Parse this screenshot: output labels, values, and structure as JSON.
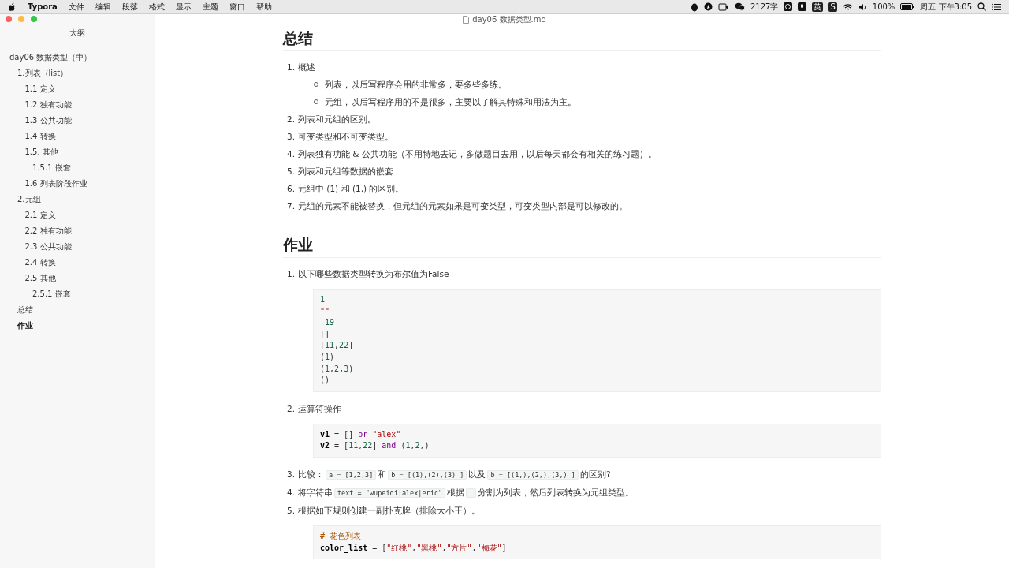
{
  "menubar": {
    "app": "Typora",
    "menus": [
      "文件",
      "编辑",
      "段落",
      "格式",
      "显示",
      "主题",
      "窗口",
      "帮助"
    ],
    "status": {
      "word_count": "2127字",
      "input_method": "英",
      "sogou": "S",
      "battery": "100%",
      "clock": "周五 下午3:05"
    }
  },
  "window": {
    "title": "day06 数据类型.md"
  },
  "sidebar": {
    "title": "大纲",
    "items": [
      {
        "label": "day06 数据类型（中）",
        "selected": false,
        "children": [
          {
            "label": "1.列表（list）",
            "selected": false,
            "children": [
              {
                "label": "1.1 定义",
                "selected": false
              },
              {
                "label": "1.2 独有功能",
                "selected": false
              },
              {
                "label": "1.3 公共功能",
                "selected": false
              },
              {
                "label": "1.4 转换",
                "selected": false
              },
              {
                "label": "1.5. 其他",
                "selected": false,
                "children": [
                  {
                    "label": "1.5.1 嵌套",
                    "selected": false
                  }
                ]
              },
              {
                "label": "1.6 列表阶段作业",
                "selected": false
              }
            ]
          },
          {
            "label": "2.元组",
            "selected": false,
            "children": [
              {
                "label": "2.1 定义",
                "selected": false
              },
              {
                "label": "2.2 独有功能",
                "selected": false
              },
              {
                "label": "2.3 公共功能",
                "selected": false
              },
              {
                "label": "2.4 转换",
                "selected": false
              },
              {
                "label": "2.5 其他",
                "selected": false,
                "children": [
                  {
                    "label": "2.5.1 嵌套",
                    "selected": false
                  }
                ]
              }
            ]
          },
          {
            "label": "总结",
            "selected": false
          },
          {
            "label": "作业",
            "selected": true
          }
        ]
      }
    ]
  },
  "document": {
    "sections": [
      {
        "heading": "总结",
        "items": [
          {
            "number": "1.",
            "parts": [
              {
                "kind": "text",
                "text": "概述"
              }
            ],
            "bullets": [
              "列表，以后写程序会用的非常多，要多些多练。",
              "元组，以后写程序用的不是很多，主要以了解其特殊和用法为主。"
            ]
          },
          {
            "number": "2.",
            "parts": [
              {
                "kind": "text",
                "text": "列表和元组的区别。"
              }
            ]
          },
          {
            "number": "3.",
            "parts": [
              {
                "kind": "text",
                "text": "可变类型和不可变类型。"
              }
            ]
          },
          {
            "number": "4.",
            "parts": [
              {
                "kind": "text",
                "text": "列表独有功能 & 公共功能（不用特地去记，多做题目去用，以后每天都会有相关的练习题）。"
              }
            ]
          },
          {
            "number": "5.",
            "parts": [
              {
                "kind": "text",
                "text": "列表和元组等数据的嵌套"
              }
            ]
          },
          {
            "number": "6.",
            "parts": [
              {
                "kind": "text",
                "text": "元组中 (1) 和 (1,) 的区别。"
              }
            ]
          },
          {
            "number": "7.",
            "parts": [
              {
                "kind": "text",
                "text": "元组的元素不能被替换，但元组的元素如果是可变类型，可变类型内部是可以修改的。"
              }
            ]
          }
        ]
      },
      {
        "heading": "作业",
        "items": [
          {
            "number": "1.",
            "parts": [
              {
                "kind": "text",
                "text": "以下哪些数据类型转换为布尔值为False"
              }
            ],
            "code": [
              [
                {
                  "kind": "number",
                  "text": "1"
                }
              ],
              [
                {
                  "kind": "string",
                  "text": "\"\""
                }
              ],
              [
                {
                  "kind": "plain",
                  "text": "-"
                },
                {
                  "kind": "number",
                  "text": "19"
                }
              ],
              [
                {
                  "kind": "plain",
                  "text": "[]"
                }
              ],
              [
                {
                  "kind": "plain",
                  "text": "["
                },
                {
                  "kind": "number",
                  "text": "11"
                },
                {
                  "kind": "plain",
                  "text": ","
                },
                {
                  "kind": "number",
                  "text": "22"
                },
                {
                  "kind": "plain",
                  "text": "]"
                }
              ],
              [
                {
                  "kind": "plain",
                  "text": "("
                },
                {
                  "kind": "number",
                  "text": "1"
                },
                {
                  "kind": "plain",
                  "text": ")"
                }
              ],
              [
                {
                  "kind": "plain",
                  "text": "("
                },
                {
                  "kind": "number",
                  "text": "1"
                },
                {
                  "kind": "plain",
                  "text": ","
                },
                {
                  "kind": "number",
                  "text": "2"
                },
                {
                  "kind": "plain",
                  "text": ","
                },
                {
                  "kind": "number",
                  "text": "3"
                },
                {
                  "kind": "plain",
                  "text": ")"
                }
              ],
              [
                {
                  "kind": "plain",
                  "text": "()"
                }
              ]
            ]
          },
          {
            "number": "2.",
            "parts": [
              {
                "kind": "text",
                "text": "运算符操作"
              }
            ],
            "code": [
              [
                {
                  "kind": "variable",
                  "text": "v1"
                },
                {
                  "kind": "plain",
                  "text": " = [] "
                },
                {
                  "kind": "keyword",
                  "text": "or"
                },
                {
                  "kind": "string",
                  "text": " \"alex\""
                }
              ],
              [
                {
                  "kind": "variable",
                  "text": "v2"
                },
                {
                  "kind": "plain",
                  "text": " = ["
                },
                {
                  "kind": "number",
                  "text": "11"
                },
                {
                  "kind": "plain",
                  "text": ","
                },
                {
                  "kind": "number",
                  "text": "22"
                },
                {
                  "kind": "plain",
                  "text": "] "
                },
                {
                  "kind": "keyword",
                  "text": "and"
                },
                {
                  "kind": "plain",
                  "text": " ("
                },
                {
                  "kind": "number",
                  "text": "1"
                },
                {
                  "kind": "plain",
                  "text": ","
                },
                {
                  "kind": "number",
                  "text": "2"
                },
                {
                  "kind": "plain",
                  "text": ",)"
                }
              ]
            ]
          },
          {
            "number": "3.",
            "parts": [
              {
                "kind": "text",
                "text": "比较："
              },
              {
                "kind": "code",
                "text": "a = [1,2,3]"
              },
              {
                "kind": "text",
                "text": "和"
              },
              {
                "kind": "code",
                "text": "b = [(1),(2),(3) ]"
              },
              {
                "kind": "text",
                "text": "以及"
              },
              {
                "kind": "code",
                "text": "b = [(1,),(2,),(3,) ]"
              },
              {
                "kind": "text",
                "text": "的区别?"
              }
            ]
          },
          {
            "number": "4.",
            "parts": [
              {
                "kind": "text",
                "text": "将字符串"
              },
              {
                "kind": "code",
                "text": "text = \"wupeiqi|alex|eric\""
              },
              {
                "kind": "text",
                "text": "根据"
              },
              {
                "kind": "code",
                "text": "|"
              },
              {
                "kind": "text",
                "text": "分割为列表，然后列表转换为元组类型。"
              }
            ]
          },
          {
            "number": "5.",
            "parts": [
              {
                "kind": "text",
                "text": "根据如下规则创建一副扑克牌（排除大小王）。"
              }
            ],
            "code": [
              [
                {
                  "kind": "comment",
                  "text": "# 花色列表"
                }
              ],
              [
                {
                  "kind": "variable",
                  "text": "color_list"
                },
                {
                  "kind": "plain",
                  "text": " = ["
                },
                {
                  "kind": "string",
                  "text": "\"红桃\""
                },
                {
                  "kind": "plain",
                  "text": ","
                },
                {
                  "kind": "string",
                  "text": "\"黑桃\""
                },
                {
                  "kind": "plain",
                  "text": ","
                },
                {
                  "kind": "string",
                  "text": "\"方片\""
                },
                {
                  "kind": "plain",
                  "text": ","
                },
                {
                  "kind": "string",
                  "text": "\"梅花\""
                },
                {
                  "kind": "plain",
                  "text": "]"
                }
              ]
            ]
          }
        ]
      }
    ]
  }
}
